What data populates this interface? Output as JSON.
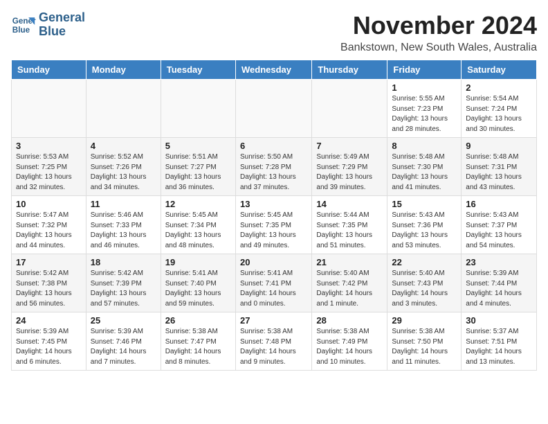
{
  "header": {
    "logo_line1": "General",
    "logo_line2": "Blue",
    "month_title": "November 2024",
    "location": "Bankstown, New South Wales, Australia"
  },
  "weekdays": [
    "Sunday",
    "Monday",
    "Tuesday",
    "Wednesday",
    "Thursday",
    "Friday",
    "Saturday"
  ],
  "weeks": [
    [
      {
        "day": "",
        "info": ""
      },
      {
        "day": "",
        "info": ""
      },
      {
        "day": "",
        "info": ""
      },
      {
        "day": "",
        "info": ""
      },
      {
        "day": "",
        "info": ""
      },
      {
        "day": "1",
        "info": "Sunrise: 5:55 AM\nSunset: 7:23 PM\nDaylight: 13 hours\nand 28 minutes."
      },
      {
        "day": "2",
        "info": "Sunrise: 5:54 AM\nSunset: 7:24 PM\nDaylight: 13 hours\nand 30 minutes."
      }
    ],
    [
      {
        "day": "3",
        "info": "Sunrise: 5:53 AM\nSunset: 7:25 PM\nDaylight: 13 hours\nand 32 minutes."
      },
      {
        "day": "4",
        "info": "Sunrise: 5:52 AM\nSunset: 7:26 PM\nDaylight: 13 hours\nand 34 minutes."
      },
      {
        "day": "5",
        "info": "Sunrise: 5:51 AM\nSunset: 7:27 PM\nDaylight: 13 hours\nand 36 minutes."
      },
      {
        "day": "6",
        "info": "Sunrise: 5:50 AM\nSunset: 7:28 PM\nDaylight: 13 hours\nand 37 minutes."
      },
      {
        "day": "7",
        "info": "Sunrise: 5:49 AM\nSunset: 7:29 PM\nDaylight: 13 hours\nand 39 minutes."
      },
      {
        "day": "8",
        "info": "Sunrise: 5:48 AM\nSunset: 7:30 PM\nDaylight: 13 hours\nand 41 minutes."
      },
      {
        "day": "9",
        "info": "Sunrise: 5:48 AM\nSunset: 7:31 PM\nDaylight: 13 hours\nand 43 minutes."
      }
    ],
    [
      {
        "day": "10",
        "info": "Sunrise: 5:47 AM\nSunset: 7:32 PM\nDaylight: 13 hours\nand 44 minutes."
      },
      {
        "day": "11",
        "info": "Sunrise: 5:46 AM\nSunset: 7:33 PM\nDaylight: 13 hours\nand 46 minutes."
      },
      {
        "day": "12",
        "info": "Sunrise: 5:45 AM\nSunset: 7:34 PM\nDaylight: 13 hours\nand 48 minutes."
      },
      {
        "day": "13",
        "info": "Sunrise: 5:45 AM\nSunset: 7:35 PM\nDaylight: 13 hours\nand 49 minutes."
      },
      {
        "day": "14",
        "info": "Sunrise: 5:44 AM\nSunset: 7:35 PM\nDaylight: 13 hours\nand 51 minutes."
      },
      {
        "day": "15",
        "info": "Sunrise: 5:43 AM\nSunset: 7:36 PM\nDaylight: 13 hours\nand 53 minutes."
      },
      {
        "day": "16",
        "info": "Sunrise: 5:43 AM\nSunset: 7:37 PM\nDaylight: 13 hours\nand 54 minutes."
      }
    ],
    [
      {
        "day": "17",
        "info": "Sunrise: 5:42 AM\nSunset: 7:38 PM\nDaylight: 13 hours\nand 56 minutes."
      },
      {
        "day": "18",
        "info": "Sunrise: 5:42 AM\nSunset: 7:39 PM\nDaylight: 13 hours\nand 57 minutes."
      },
      {
        "day": "19",
        "info": "Sunrise: 5:41 AM\nSunset: 7:40 PM\nDaylight: 13 hours\nand 59 minutes."
      },
      {
        "day": "20",
        "info": "Sunrise: 5:41 AM\nSunset: 7:41 PM\nDaylight: 14 hours\nand 0 minutes."
      },
      {
        "day": "21",
        "info": "Sunrise: 5:40 AM\nSunset: 7:42 PM\nDaylight: 14 hours\nand 1 minute."
      },
      {
        "day": "22",
        "info": "Sunrise: 5:40 AM\nSunset: 7:43 PM\nDaylight: 14 hours\nand 3 minutes."
      },
      {
        "day": "23",
        "info": "Sunrise: 5:39 AM\nSunset: 7:44 PM\nDaylight: 14 hours\nand 4 minutes."
      }
    ],
    [
      {
        "day": "24",
        "info": "Sunrise: 5:39 AM\nSunset: 7:45 PM\nDaylight: 14 hours\nand 6 minutes."
      },
      {
        "day": "25",
        "info": "Sunrise: 5:39 AM\nSunset: 7:46 PM\nDaylight: 14 hours\nand 7 minutes."
      },
      {
        "day": "26",
        "info": "Sunrise: 5:38 AM\nSunset: 7:47 PM\nDaylight: 14 hours\nand 8 minutes."
      },
      {
        "day": "27",
        "info": "Sunrise: 5:38 AM\nSunset: 7:48 PM\nDaylight: 14 hours\nand 9 minutes."
      },
      {
        "day": "28",
        "info": "Sunrise: 5:38 AM\nSunset: 7:49 PM\nDaylight: 14 hours\nand 10 minutes."
      },
      {
        "day": "29",
        "info": "Sunrise: 5:38 AM\nSunset: 7:50 PM\nDaylight: 14 hours\nand 11 minutes."
      },
      {
        "day": "30",
        "info": "Sunrise: 5:37 AM\nSunset: 7:51 PM\nDaylight: 14 hours\nand 13 minutes."
      }
    ]
  ]
}
